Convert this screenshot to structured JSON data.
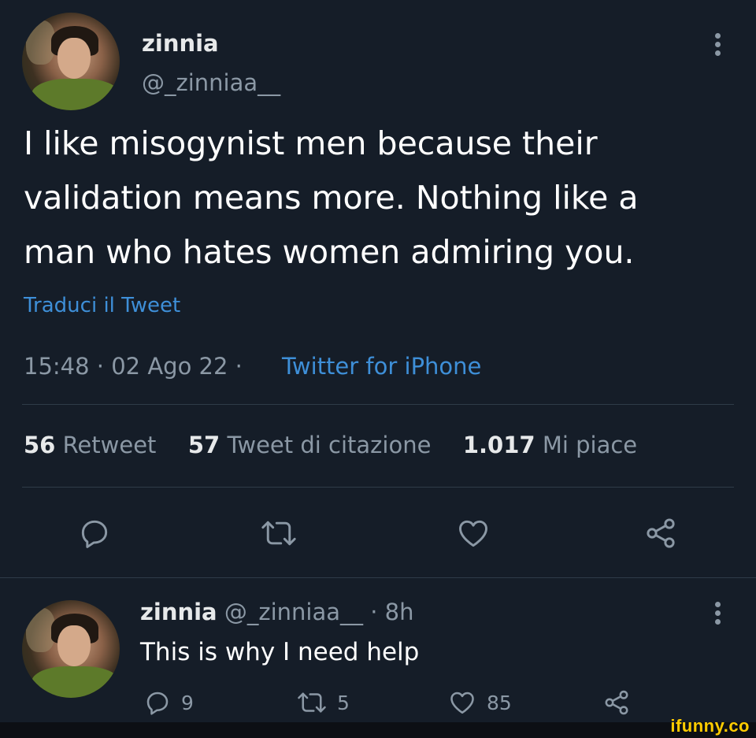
{
  "main_tweet": {
    "display_name": "zinnia",
    "handle": "@_zinniaa__",
    "text_lines": [
      "I like misogynist men because their",
      "validation means more. Nothing like a",
      "man who hates women admiring you."
    ],
    "translate_label": "Traduci il Tweet",
    "meta_time": "15:48 · 02 Ago 22 ·",
    "meta_source": "Twitter for iPhone",
    "stats": {
      "retweets_count": "56",
      "retweets_label": "Retweet",
      "quotes_count": "57",
      "quotes_label": "Tweet di citazione",
      "likes_count": "1.017",
      "likes_label": "Mi piace"
    },
    "actions": [
      "reply-icon",
      "retweet-icon",
      "like-icon",
      "share-icon"
    ]
  },
  "reply_tweet": {
    "display_name": "zinnia",
    "handle_time": "@_zinniaa__ · 8h",
    "text": "This is why I need help",
    "reply_count": "9",
    "retweet_count": "5",
    "like_count": "85"
  },
  "watermark": "ifunny.co",
  "colors": {
    "background": "#151d28",
    "text": "#e7e9ea",
    "muted": "#8b98a5",
    "accent": "#1d9bf0"
  }
}
